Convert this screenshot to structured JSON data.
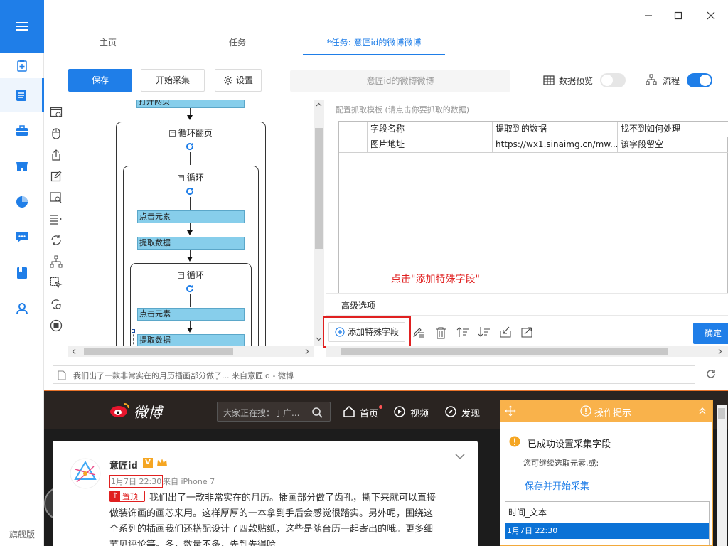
{
  "sidebar": {
    "version_label": "旗舰版"
  },
  "tabs": [
    {
      "label": "主页"
    },
    {
      "label": "任务"
    },
    {
      "label": "*任务: 意匠id的微博微博"
    }
  ],
  "toolbar": {
    "save_label": "保存",
    "start_label": "开始采集",
    "settings_label": "设置",
    "task_name": "意匠id的微博微博",
    "preview_label": "数据预览",
    "flow_label": "流程"
  },
  "flow": {
    "top_step": "打开网页",
    "page_loop": "循环翻页",
    "loop1": "循环",
    "click1": "点击元素",
    "extract1": "提取数据",
    "loop2": "循环",
    "click2": "点击元素",
    "extract2": "提取数据"
  },
  "config": {
    "title": "配置抓取模板 (请点击你要抓取的数据)",
    "columns": [
      "字段名称",
      "提取到的数据",
      "找不到如何处理"
    ],
    "rows": [
      {
        "name": "图片地址",
        "value": "https://wx1.sinaimg.cn/mw...",
        "handling": "该字段留空"
      }
    ],
    "annotation": "点击\"添加特殊字段\"",
    "advanced_label": "高级选项",
    "add_special_field": "添加特殊字段",
    "confirm_label": "确定"
  },
  "browser": {
    "address": "我们出了一款非常实在的月历插画部分做了... 来自意匠id - 微博"
  },
  "weibo": {
    "logo_text": "微博",
    "search_placeholder": "大家正在搜：丁广...",
    "nav": [
      "首页",
      "视频",
      "发现"
    ],
    "author": "意匠id",
    "time": "1月7日 22:30",
    "source": "来自 iPhone 7",
    "pin_label": "置顶",
    "post_lines": [
      "我们出了一款非常实在的月历。插画部分做了齿孔，撕下来就可以直接",
      "做装饰画的画芯来用。这样厚厚的一本拿到手后会感觉很踏实。另外呢，围绕这",
      "个系列的插画我们还搭配设计了四款贴纸，这些是随台历一起寄出的哦。更多细",
      "节见评论等。冬，数量不多，先到先得哈..."
    ]
  },
  "tips": {
    "header": "操作提示",
    "success": "已成功设置采集字段",
    "continue": "您可继续选取元素,或:",
    "save_start": "保存并开始采集",
    "list": [
      "时间_文本",
      "1月7日 22:30"
    ]
  },
  "colors": {
    "accent": "#1f7ee8",
    "step": "#87ceeb",
    "tips": "#f9b24b",
    "annotation": "#e02020"
  }
}
